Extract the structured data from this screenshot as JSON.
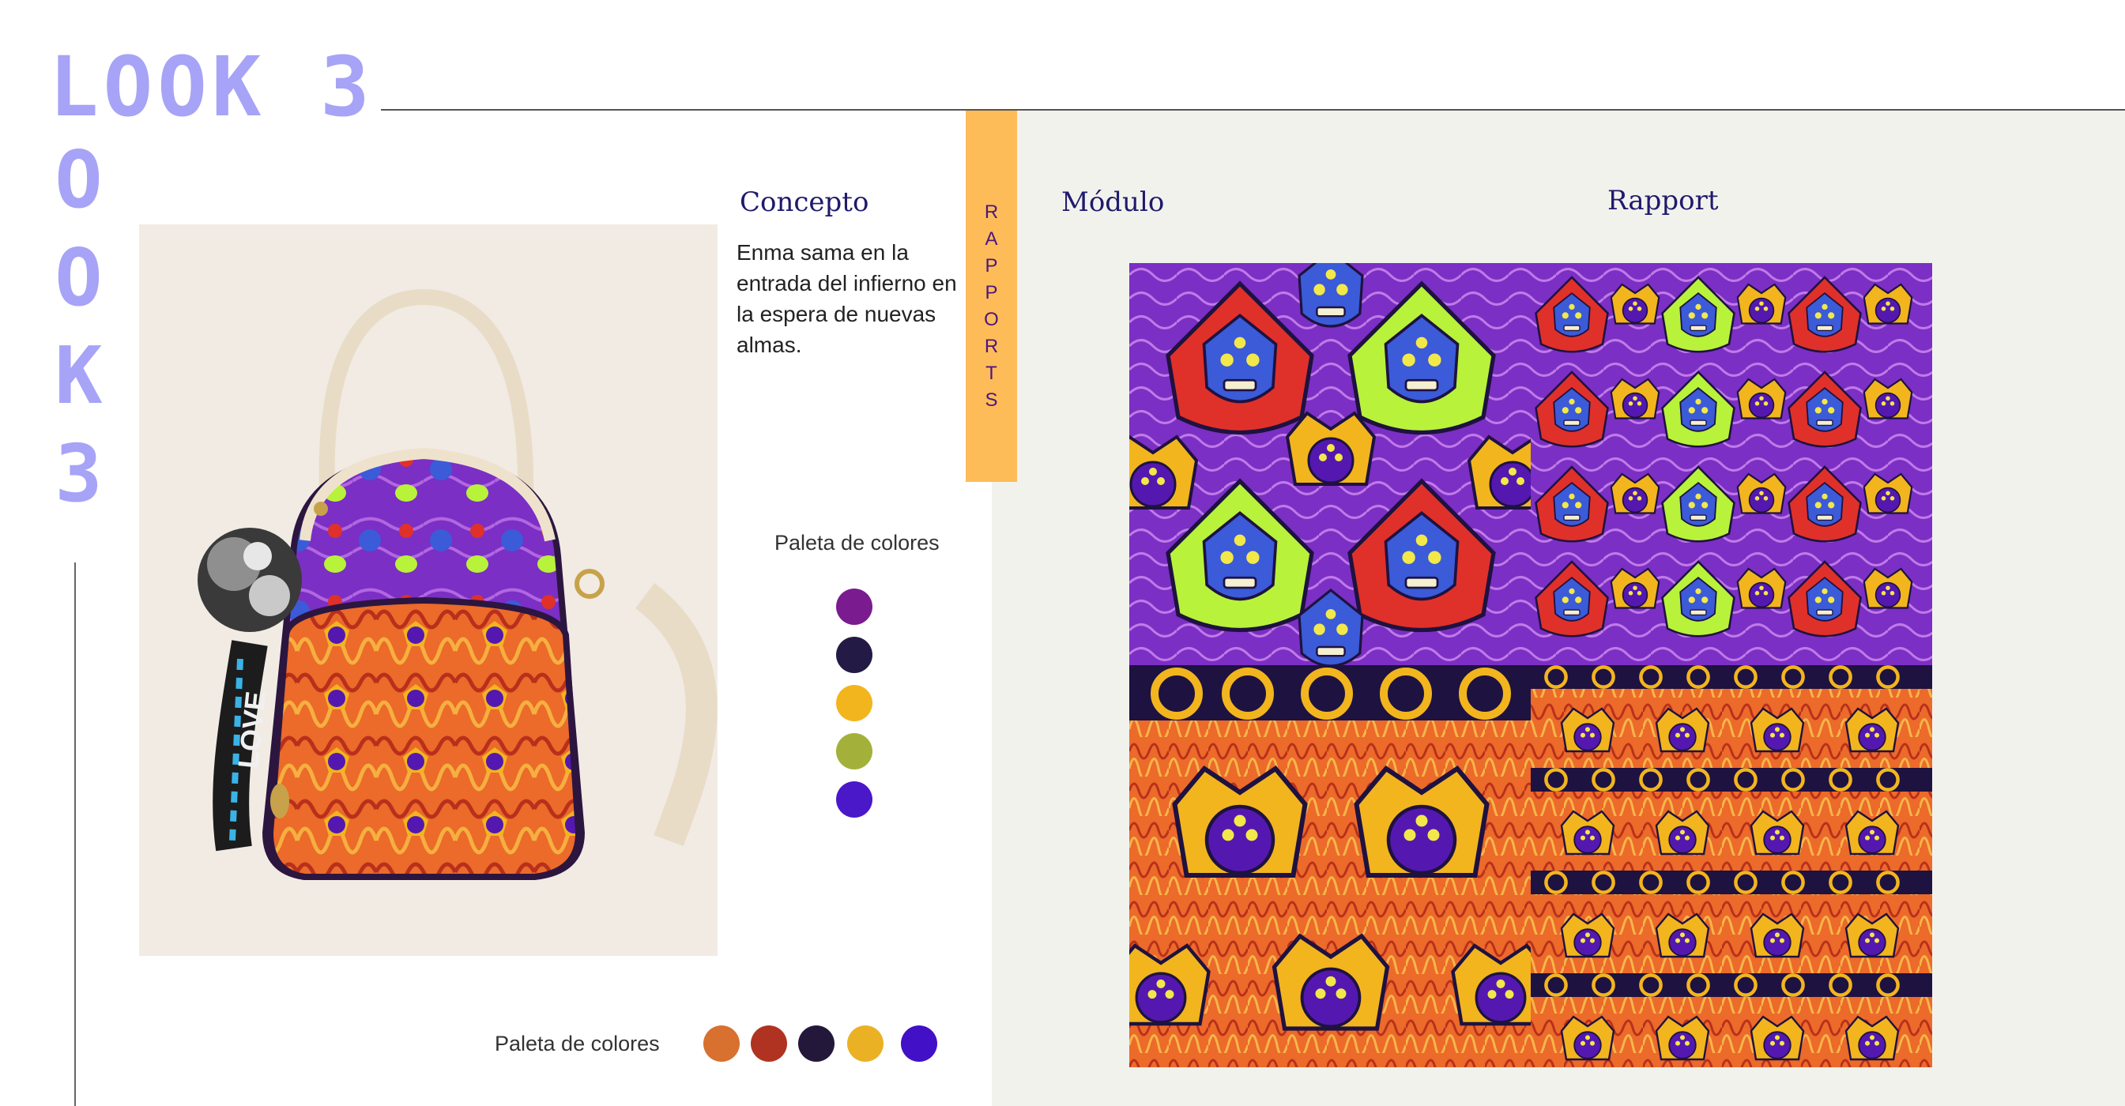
{
  "look": {
    "title": "LOOK 3",
    "vertical_letters": [
      "O",
      "O",
      "K",
      "3"
    ]
  },
  "concepto": {
    "title": "Concepto",
    "text": "Enma sama en la entrada del infierno en la espera de nuevas almas."
  },
  "tab": {
    "letters": [
      "R",
      "A",
      "P",
      "P",
      "O",
      "R",
      "T",
      "S"
    ]
  },
  "palette_top": {
    "label": "Paleta de colores",
    "colors": [
      "#7a1b8f",
      "#231a45",
      "#f2b51e",
      "#a3b13a",
      "#4a17c9"
    ]
  },
  "palette_bottom": {
    "label": "Paleta de colores",
    "colors": [
      "#d87030",
      "#b03322",
      "#24183a",
      "#eab125",
      "#4210c6"
    ]
  },
  "modulo": {
    "title": "Módulo"
  },
  "rapport": {
    "title": "Rapport"
  },
  "bag": {
    "strap_text": "LOVE"
  },
  "pattern_colors": {
    "purple": "#7b2fc4",
    "violet": "#5418b0",
    "blue_face": "#3b5bd8",
    "lime": "#b8f23a",
    "red": "#e0302a",
    "gold": "#f2b51e",
    "orange": "#ec6a2a",
    "dark": "#1e1240"
  }
}
